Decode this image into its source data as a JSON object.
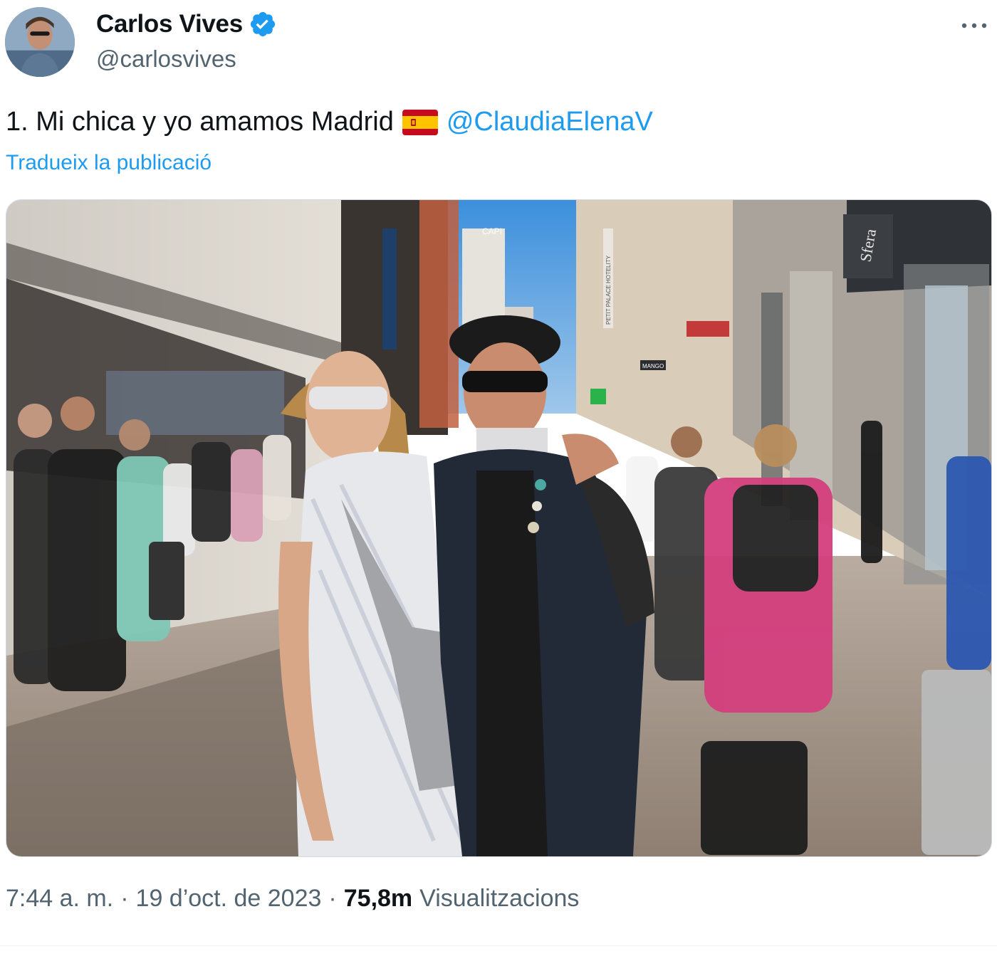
{
  "author": {
    "display_name": "Carlos Vives",
    "handle": "@carlosvives",
    "verified": true,
    "verified_color": "#1d9bf0"
  },
  "tweet": {
    "text_before": "1. Mi chica y yo amamos Madrid",
    "flag_icon": "spain-flag-emoji",
    "mention": "@ClaudiaElenaV",
    "translate_label": "Tradueix la publicació"
  },
  "photo": {
    "storefront_label": "Sfera",
    "sign_store": "MANGO",
    "sign_hotel": "PETIT PALACE HOTELITY",
    "sign_capitol": "CAPI"
  },
  "meta": {
    "time": "7:44 a. m.",
    "sep1": "·",
    "date": "19 d’oct. de 2023",
    "sep2": "·",
    "views_count": "75,8m",
    "views_label": "Visualitzacions"
  },
  "colors": {
    "accent": "#1d9bf0",
    "text_primary": "#0f1419",
    "text_secondary": "#536471"
  },
  "icons": {
    "more": "more-horizontal-icon",
    "verified": "verified-badge-icon"
  }
}
